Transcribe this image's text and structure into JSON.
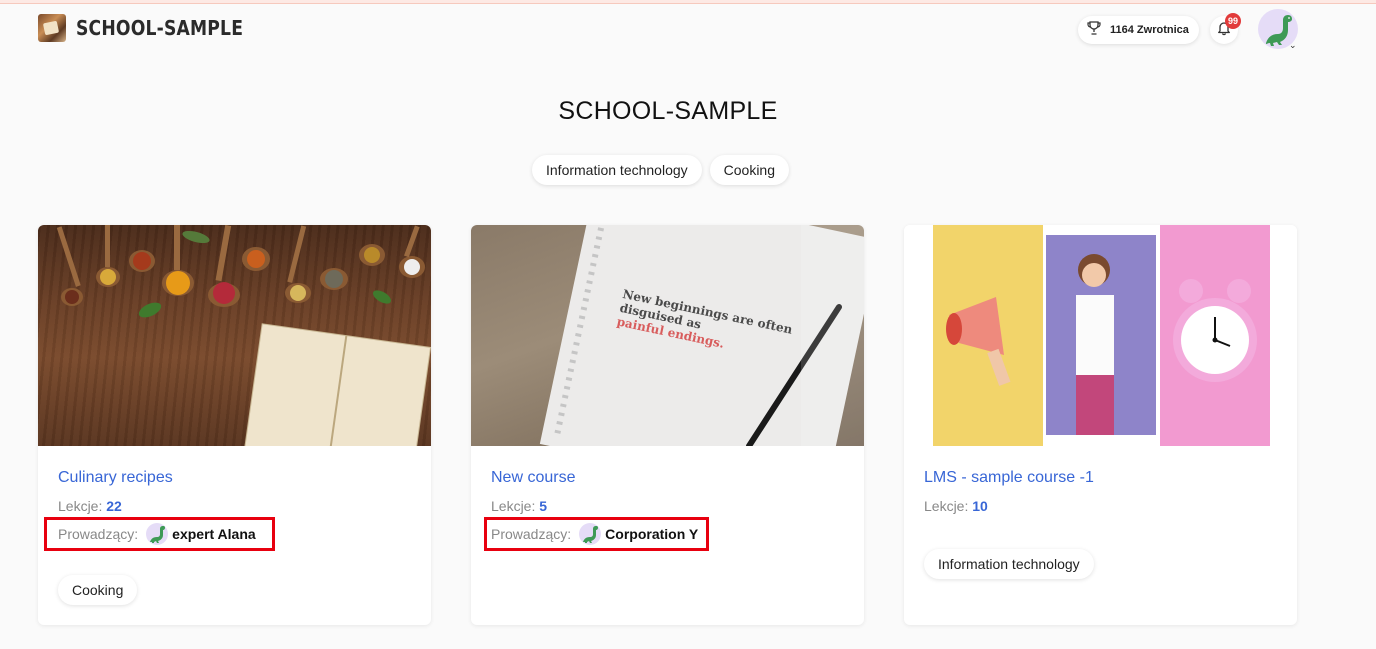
{
  "header": {
    "brand": "SCHOOL-SAMPLE",
    "points": "1164 Zwrotnica",
    "notifications_count": "99"
  },
  "page": {
    "title": "SCHOOL-SAMPLE",
    "categories": [
      "Information technology",
      "Cooking"
    ]
  },
  "courses": [
    {
      "title": "Culinary recipes",
      "lessons_label": "Lekcje:",
      "lessons": "22",
      "instructor_label": "Prowadzący:",
      "instructor": "expert Alana",
      "tag": "Cooking"
    },
    {
      "title": "New course",
      "lessons_label": "Lekcje:",
      "lessons": "5",
      "instructor_label": "Prowadzący:",
      "instructor": "Corporation Y",
      "image_text": [
        "New beginnings are often",
        "disguised as",
        "painful endings."
      ]
    },
    {
      "title": "LMS - sample course -1",
      "lessons_label": "Lekcje:",
      "lessons": "10",
      "tag": "Information technology"
    }
  ],
  "colors": {
    "link": "#3866d6",
    "highlight": "#e8000f",
    "badge": "#e23b3b"
  }
}
